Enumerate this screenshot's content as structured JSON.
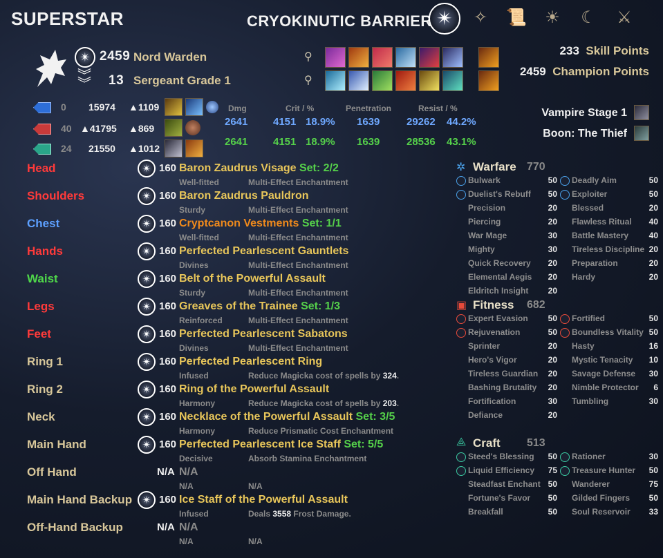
{
  "header": {
    "title": "SUPERSTAR",
    "build_name": "CRYOKINUTIC BARRIER",
    "tab_icons": [
      "sun-compass-icon",
      "constellation-icon",
      "scroll-icon",
      "sun-icon",
      "moon-icon",
      "group-icon"
    ]
  },
  "character": {
    "level_cp": "2459",
    "race_class": "Nord Warden",
    "rank": "13",
    "rank_title": "Sergeant Grade 1",
    "skill_points_value": "233",
    "skill_points_label": "Skill Points",
    "champion_points_value": "2459",
    "champion_points_label": "Champion Points"
  },
  "resources": [
    {
      "color": "#2d6ed8",
      "regen": "0",
      "max": "15974",
      "recovery": "1109"
    },
    {
      "color": "#c83a3a",
      "regen": "40",
      "max": "41795",
      "recovery": "869",
      "max_prefix": "▲"
    },
    {
      "color": "#2aa589",
      "regen": "24",
      "max": "21550",
      "recovery": "1012"
    }
  ],
  "stats": {
    "headers": {
      "dmg": "Dmg",
      "crit": "Crit / %",
      "pen": "Penetration",
      "resist": "Resist / %"
    },
    "magic": {
      "dmg": "2641",
      "crit": "4151",
      "crit_pct": "18.9%",
      "pen": "1639",
      "resist": "29262",
      "resist_pct": "44.2%"
    },
    "physical": {
      "dmg": "2641",
      "crit": "4151",
      "crit_pct": "18.9%",
      "pen": "1639",
      "resist": "28536",
      "resist_pct": "43.1%"
    }
  },
  "buffs": {
    "vampire": "Vampire Stage 1",
    "boon": "Boon: The Thief"
  },
  "gear": [
    {
      "slot": "Head",
      "slot_color": "#ff3a3a",
      "level": "160",
      "name": "Baron Zaudrus Visage",
      "name_color": "#e8c65a",
      "set": "Set: 2/2",
      "trait": "Well-fitted",
      "enchant": "Multi-Effect Enchantment"
    },
    {
      "slot": "Shoulders",
      "slot_color": "#ff3a3a",
      "level": "160",
      "name": "Baron Zaudrus Pauldron",
      "name_color": "#e8c65a",
      "set": "",
      "trait": "Sturdy",
      "enchant": "Multi-Effect Enchantment"
    },
    {
      "slot": "Chest",
      "slot_color": "#5da0ff",
      "level": "160",
      "name": "Cryptcanon Vestments",
      "name_color": "#f08a1c",
      "set": "Set: 1/1",
      "trait": "Well-fitted",
      "enchant": "Multi-Effect Enchantment"
    },
    {
      "slot": "Hands",
      "slot_color": "#ff3a3a",
      "level": "160",
      "name": "Perfected Pearlescent Gauntlets",
      "name_color": "#e8c65a",
      "set": "",
      "trait": "Divines",
      "enchant": "Multi-Effect Enchantment"
    },
    {
      "slot": "Waist",
      "slot_color": "#4fd64a",
      "level": "160",
      "name": "Belt of the Powerful Assault",
      "name_color": "#e8c65a",
      "set": "",
      "trait": "Sturdy",
      "enchant": "Multi-Effect Enchantment"
    },
    {
      "slot": "Legs",
      "slot_color": "#ff3a3a",
      "level": "160",
      "name": "Greaves of the Trainee",
      "name_color": "#e8c65a",
      "set": "Set: 1/3",
      "trait": "Reinforced",
      "enchant": "Multi-Effect Enchantment"
    },
    {
      "slot": "Feet",
      "slot_color": "#ff3a3a",
      "level": "160",
      "name": "Perfected Pearlescent Sabatons",
      "name_color": "#e8c65a",
      "set": "",
      "trait": "Divines",
      "enchant": "Multi-Effect Enchantment"
    },
    {
      "slot": "Ring 1",
      "slot_color": "#d8c79a",
      "level": "160",
      "name": "Perfected Pearlescent Ring",
      "name_color": "#e8c65a",
      "set": "",
      "trait": "Infused",
      "enchant": "Reduce Magicka cost of spells by",
      "enchant_num": "324",
      "enchant_end": "."
    },
    {
      "slot": "Ring 2",
      "slot_color": "#d8c79a",
      "level": "160",
      "name": "Ring of the Powerful Assault",
      "name_color": "#e8c65a",
      "set": "",
      "trait": "Harmony",
      "enchant": "Reduce Magicka cost of spells by",
      "enchant_num": "203",
      "enchant_end": "."
    },
    {
      "slot": "Neck",
      "slot_color": "#d8c79a",
      "level": "160",
      "name": "Necklace of the Powerful Assault",
      "name_color": "#e8c65a",
      "set": "Set: 3/5",
      "trait": "Harmony",
      "enchant": "Reduce Prismatic Cost Enchantment"
    },
    {
      "slot": "Main Hand",
      "slot_color": "#d8c79a",
      "level": "160",
      "name": "Perfected Pearlescent Ice Staff",
      "name_color": "#e8c65a",
      "set": "Set: 5/5",
      "trait": "Decisive",
      "enchant": "Absorb Stamina Enchantment"
    },
    {
      "slot": "Off Hand",
      "slot_color": "#d8c79a",
      "level": "N/A",
      "name": "N/A",
      "name_color": "#8a8a8a",
      "set": "",
      "trait": "N/A",
      "enchant": "N/A",
      "no_icon": true
    },
    {
      "slot": "Main Hand Backup",
      "slot_color": "#d8c79a",
      "level": "160",
      "name": "Ice Staff of the Powerful Assault",
      "name_color": "#e8c65a",
      "set": "",
      "trait": "Infused",
      "enchant": "Deals",
      "enchant_num": "3558",
      "enchant_end": "Frost Damage."
    },
    {
      "slot": "Off-Hand Backup",
      "slot_color": "#d8c79a",
      "level": "N/A",
      "name": "N/A",
      "name_color": "#8a8a8a",
      "set": "",
      "trait": "N/A",
      "enchant": "N/A",
      "no_icon": true
    }
  ],
  "champion": {
    "warfare": {
      "title": "Warfare",
      "total": "770",
      "color": "#4aa0e8",
      "left": [
        {
          "name": "Bulwark",
          "value": "50",
          "slotted": true
        },
        {
          "name": "Duelist's Rebuff",
          "value": "50",
          "slotted": true
        },
        {
          "name": "Precision",
          "value": "20"
        },
        {
          "name": "Piercing",
          "value": "20"
        },
        {
          "name": "War Mage",
          "value": "30"
        },
        {
          "name": "Mighty",
          "value": "30"
        },
        {
          "name": "Quick Recovery",
          "value": "20"
        },
        {
          "name": "Elemental Aegis",
          "value": "20"
        },
        {
          "name": "Eldritch Insight",
          "value": "20"
        }
      ],
      "right": [
        {
          "name": "Deadly Aim",
          "value": "50",
          "slotted": true
        },
        {
          "name": "Exploiter",
          "value": "50",
          "slotted": true
        },
        {
          "name": "Blessed",
          "value": "20"
        },
        {
          "name": "Flawless Ritual",
          "value": "40"
        },
        {
          "name": "Battle Mastery",
          "value": "40"
        },
        {
          "name": "Tireless Discipline",
          "value": "20"
        },
        {
          "name": "Preparation",
          "value": "20"
        },
        {
          "name": "Hardy",
          "value": "20"
        }
      ]
    },
    "fitness": {
      "title": "Fitness",
      "total": "682",
      "color": "#e84a3a",
      "left": [
        {
          "name": "Expert Evasion",
          "value": "50",
          "slotted": true
        },
        {
          "name": "Rejuvenation",
          "value": "50",
          "slotted": true
        },
        {
          "name": "Sprinter",
          "value": "20"
        },
        {
          "name": "Hero's Vigor",
          "value": "20"
        },
        {
          "name": "Tireless Guardian",
          "value": "20"
        },
        {
          "name": "Bashing Brutality",
          "value": "20"
        },
        {
          "name": "Fortification",
          "value": "30"
        },
        {
          "name": "Defiance",
          "value": "20"
        }
      ],
      "right": [
        {
          "name": "Fortified",
          "value": "50",
          "slotted": true
        },
        {
          "name": "Boundless Vitality",
          "value": "50",
          "slotted": true
        },
        {
          "name": "Hasty",
          "value": "16"
        },
        {
          "name": "Mystic Tenacity",
          "value": "10"
        },
        {
          "name": "Savage Defense",
          "value": "30"
        },
        {
          "name": "Nimble Protector",
          "value": "6"
        },
        {
          "name": "Tumbling",
          "value": "30"
        }
      ]
    },
    "craft": {
      "title": "Craft",
      "total": "513",
      "color": "#3ac8a0",
      "left": [
        {
          "name": "Steed's Blessing",
          "value": "50",
          "slotted": true
        },
        {
          "name": "Liquid Efficiency",
          "value": "75",
          "slotted": true
        },
        {
          "name": "Steadfast Enchant",
          "value": "50"
        },
        {
          "name": "Fortune's Favor",
          "value": "50"
        },
        {
          "name": "Breakfall",
          "value": "50"
        }
      ],
      "right": [
        {
          "name": "Rationer",
          "value": "30",
          "slotted": true
        },
        {
          "name": "Treasure Hunter",
          "value": "50",
          "slotted": true
        },
        {
          "name": "Wanderer",
          "value": "75"
        },
        {
          "name": "Gilded Fingers",
          "value": "50"
        },
        {
          "name": "Soul Reservoir",
          "value": "33"
        }
      ]
    }
  }
}
